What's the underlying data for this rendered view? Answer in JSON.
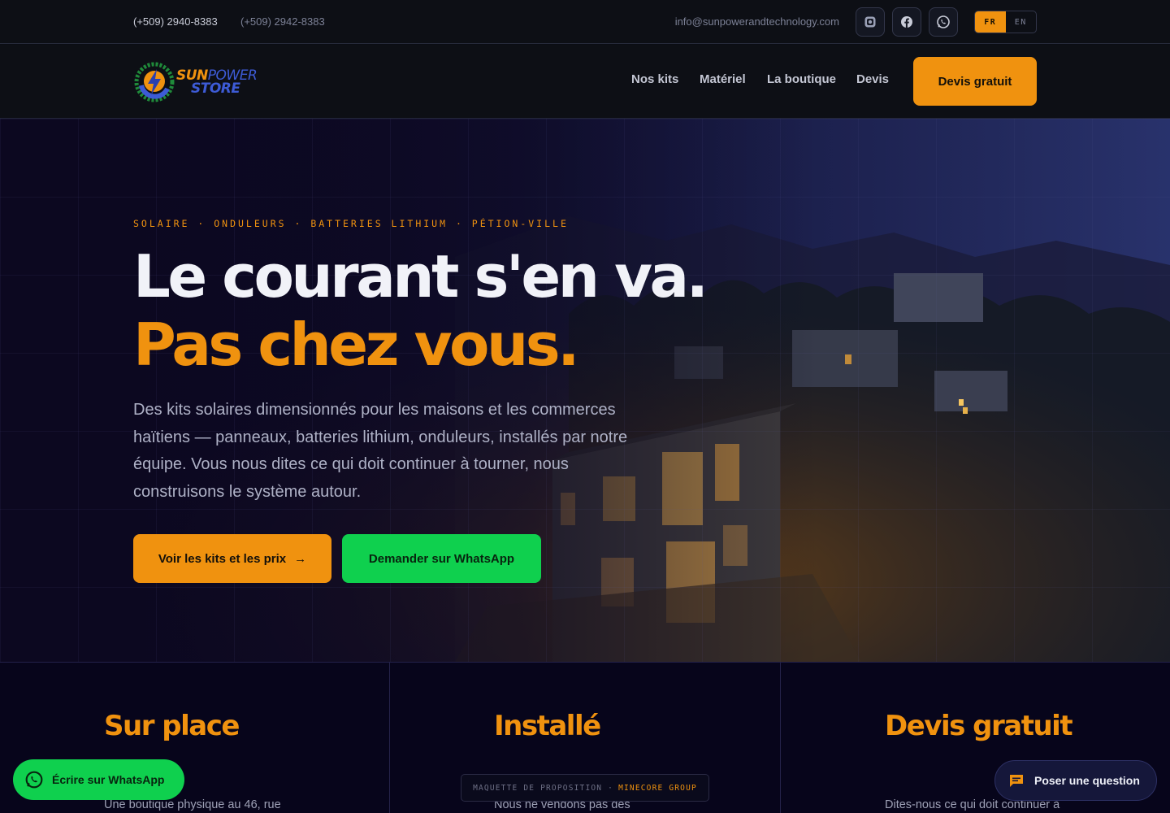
{
  "topbar": {
    "phone_primary": "(+509) 2940-8383",
    "phone_secondary": "(+509) 2942-8383",
    "email": "info@sunpowerandtechnology.com",
    "social": [
      "instagram-icon",
      "facebook-icon",
      "whatsapp-icon"
    ],
    "lang": {
      "active": "FR",
      "other": "EN"
    }
  },
  "nav": {
    "logo_line1_a": "SUN",
    "logo_line1_b": "POWER",
    "logo_line2": "STORE",
    "links": [
      "Nos kits",
      "Matériel",
      "La boutique",
      "Devis"
    ],
    "cta": "Devis gratuit"
  },
  "hero": {
    "eyebrow": "SOLAIRE · ONDULEURS · BATTERIES LITHIUM · PÉTION-VILLE",
    "title_line1": "Le courant s'en va.",
    "title_line2": "Pas chez vous.",
    "lead": "Des kits solaires dimensionnés pour les maisons et les commerces haïtiens — panneaux, batteries lithium, onduleurs, installés par notre équipe. Vous nous dites ce qui doit continuer à tourner, nous construisons le système autour.",
    "btn_primary": "Voir les kits et les prix",
    "btn_primary_arrow": "→",
    "btn_whatsapp": "Demander sur WhatsApp"
  },
  "features": [
    {
      "title": "Sur place",
      "text": "Une boutique physique au 46, rue"
    },
    {
      "title": "Installé",
      "text": "Nous ne vendons pas des"
    },
    {
      "title": "Devis gratuit",
      "text": "Dites-nous ce qui doit continuer à"
    }
  ],
  "mock_badge": {
    "left": "MAQUETTE DE PROPOSITION ·",
    "right": "MINECORE GROUP"
  },
  "floating": {
    "whatsapp": "Écrire sur WhatsApp",
    "ask": "Poser une question"
  },
  "colors": {
    "accent": "#f0920f",
    "whatsapp": "#0fd04e",
    "navy": "#07051b",
    "brand_blue": "#3d5bd6"
  }
}
